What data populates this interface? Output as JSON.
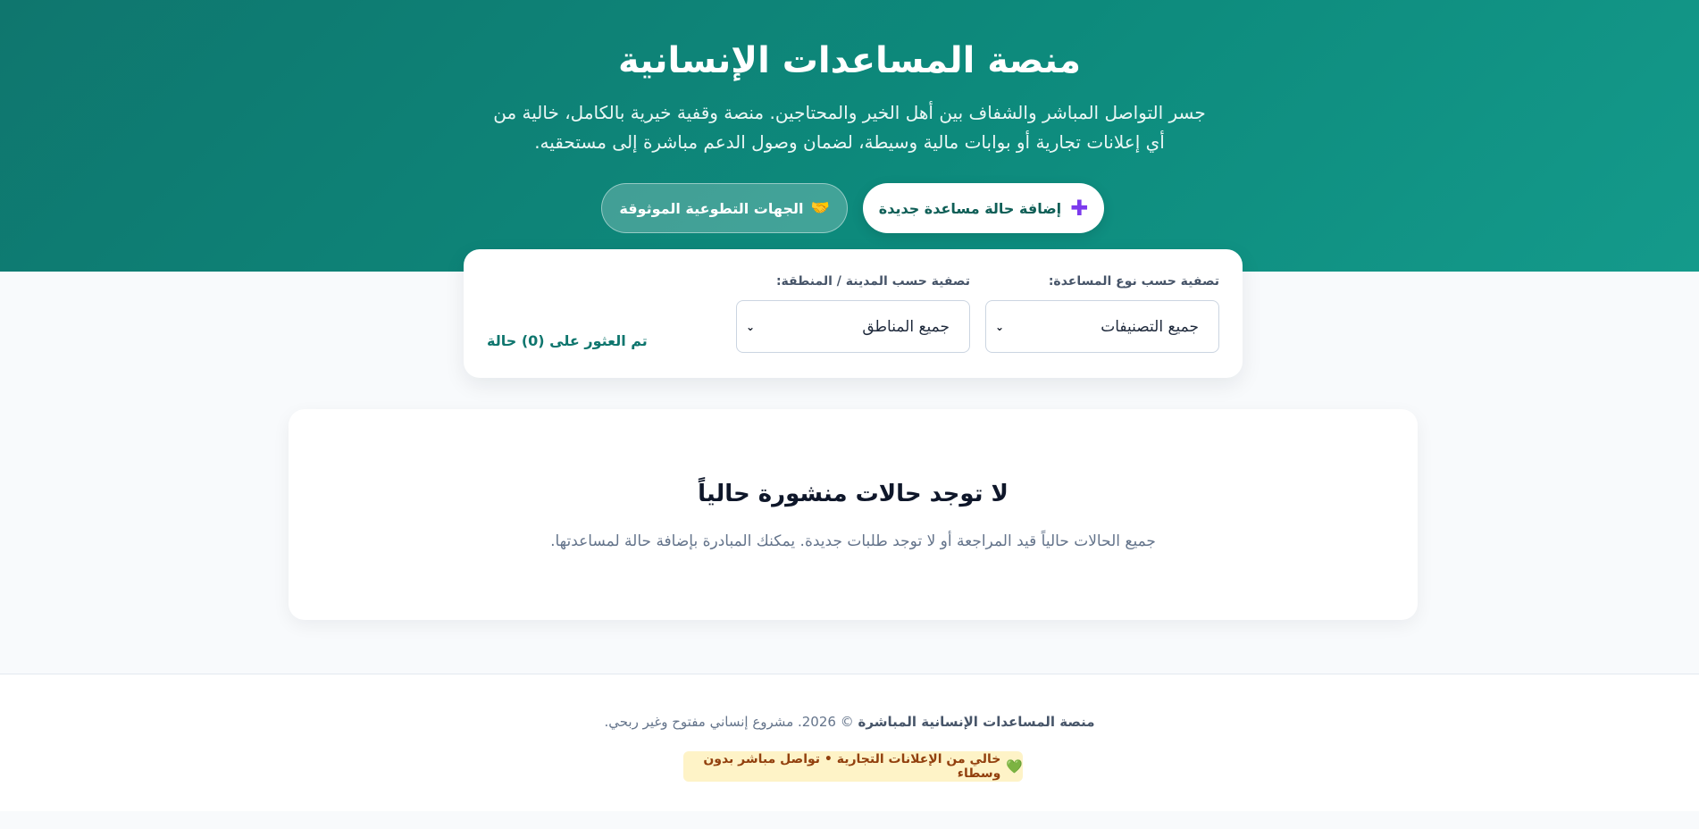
{
  "header": {
    "title": "منصة المساعدات الإنسانية",
    "subtitle_line1": "جسر التواصل المباشر والشفاف بين أهل الخير والمحتاجين. منصة وقفية خيرية بالكامل، خالية من",
    "subtitle_line2": "أي إعلانات تجارية أو بوابات مالية وسيطة، لضمان وصول الدعم مباشرة إلى مستحقيه.",
    "add_case_label": "إضافة حالة مساعدة جديدة",
    "add_case_icon": "plus-icon",
    "orgs_label": "الجهات التطوعية الموثوقة",
    "orgs_icon": "handshake-icon"
  },
  "filters": {
    "type_label": "تصفية حسب نوع المساعدة:",
    "type_value": "جميع التصنيفات",
    "city_label": "تصفية حسب المدينة / المنطقة:",
    "city_value": "جميع المناطق",
    "results_text": "تم العثور على (0) حالة"
  },
  "empty_state": {
    "title": "لا توجد حالات منشورة حالياً",
    "description": "جميع الحالات حالياً قيد المراجعة أو لا توجد طلبات جديدة. يمكنك المبادرة بإضافة حالة لمساعدتها."
  },
  "footer": {
    "brand": "منصة المساعدات الإنسانية المباشرة",
    "copyright": "© 2026. مشروع إنساني مفتوح وغير ربحي.",
    "badge": "خالي من الإعلانات التجارية • تواصل مباشر بدون وسطاء",
    "badge_icon": "heart-icon"
  },
  "colors": {
    "hero_primary": "#0f766e",
    "accent_plus": "#7c3aed",
    "results_text": "#0f766e",
    "badge_bg": "#fef3c7",
    "badge_text": "#92400e"
  }
}
